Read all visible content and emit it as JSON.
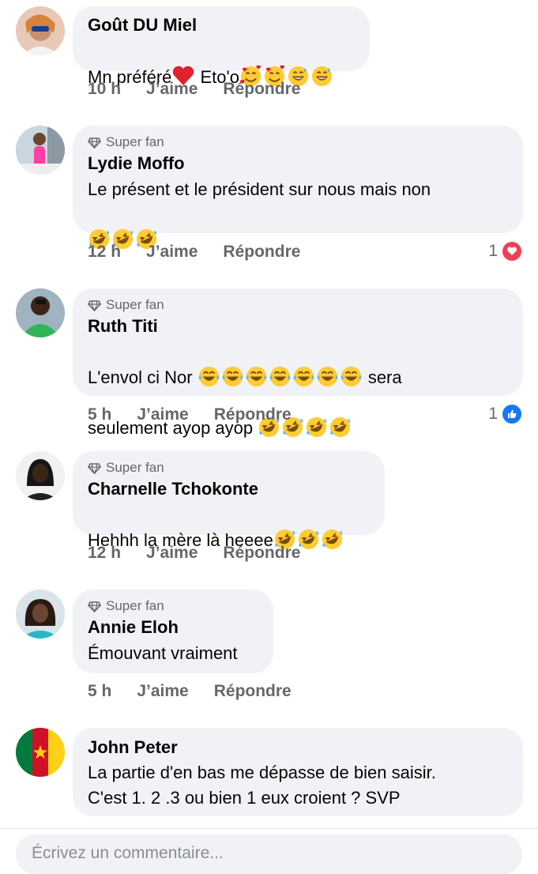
{
  "comments": [
    {
      "author": "Goût DU Miel",
      "badge": "",
      "text_parts": [
        "Mn préféré",
        "heart",
        " Eto'o",
        "hearts-face",
        "hearts-face",
        "grin-sweat",
        "grin-sweat"
      ],
      "time": "10 h",
      "like_label": "J’aime",
      "reply_label": "Répondre",
      "reaction": null
    },
    {
      "author": "Lydie Moffo",
      "badge": "Super fan",
      "line1": "Le présent et le président sur nous mais non",
      "line2_emojis": [
        "rofl",
        "rofl",
        "rofl"
      ],
      "time": "12 h",
      "like_label": "J’aime",
      "reply_label": "Répondre",
      "reaction": {
        "count": "1",
        "type": "love"
      }
    },
    {
      "author": "Ruth Titi",
      "badge": "Super fan",
      "line1_start": "L'envol ci Nor ",
      "line1_emojis": [
        "joy",
        "joy",
        "joy",
        "joy",
        "joy",
        "joy",
        "joy"
      ],
      "line1_end": " sera",
      "line2_text": "seulement ayop ayop ",
      "line2_emojis": [
        "rofl",
        "rofl",
        "rofl",
        "rofl"
      ],
      "time": "5 h",
      "like_label": "J’aime",
      "reply_label": "Répondre",
      "reaction": {
        "count": "1",
        "type": "like"
      }
    },
    {
      "author": "Charnelle Tchokonte",
      "badge": "Super fan",
      "text": "Hehhh la mère là heeee",
      "emojis": [
        "rofl",
        "rofl",
        "rofl"
      ],
      "time": "12 h",
      "like_label": "J’aime",
      "reply_label": "Répondre",
      "reaction": null
    },
    {
      "author": "Annie Eloh",
      "badge": "Super fan",
      "text": "Émouvant vraiment",
      "time": "5 h",
      "like_label": "J’aime",
      "reply_label": "Répondre",
      "reaction": null
    },
    {
      "author": "John Peter",
      "badge": "",
      "line1": "La partie d'en bas me dépasse de bien saisir.",
      "line2": "C'est 1. 2 .3 ou bien 1 eux croient ? SVP",
      "reaction": null
    }
  ],
  "composer": {
    "placeholder": "Écrivez un commentaire..."
  },
  "colors": {
    "bubble": "#f0f2f5",
    "meta": "#65676b",
    "love": "#f33e58",
    "like": "#1877f2"
  }
}
